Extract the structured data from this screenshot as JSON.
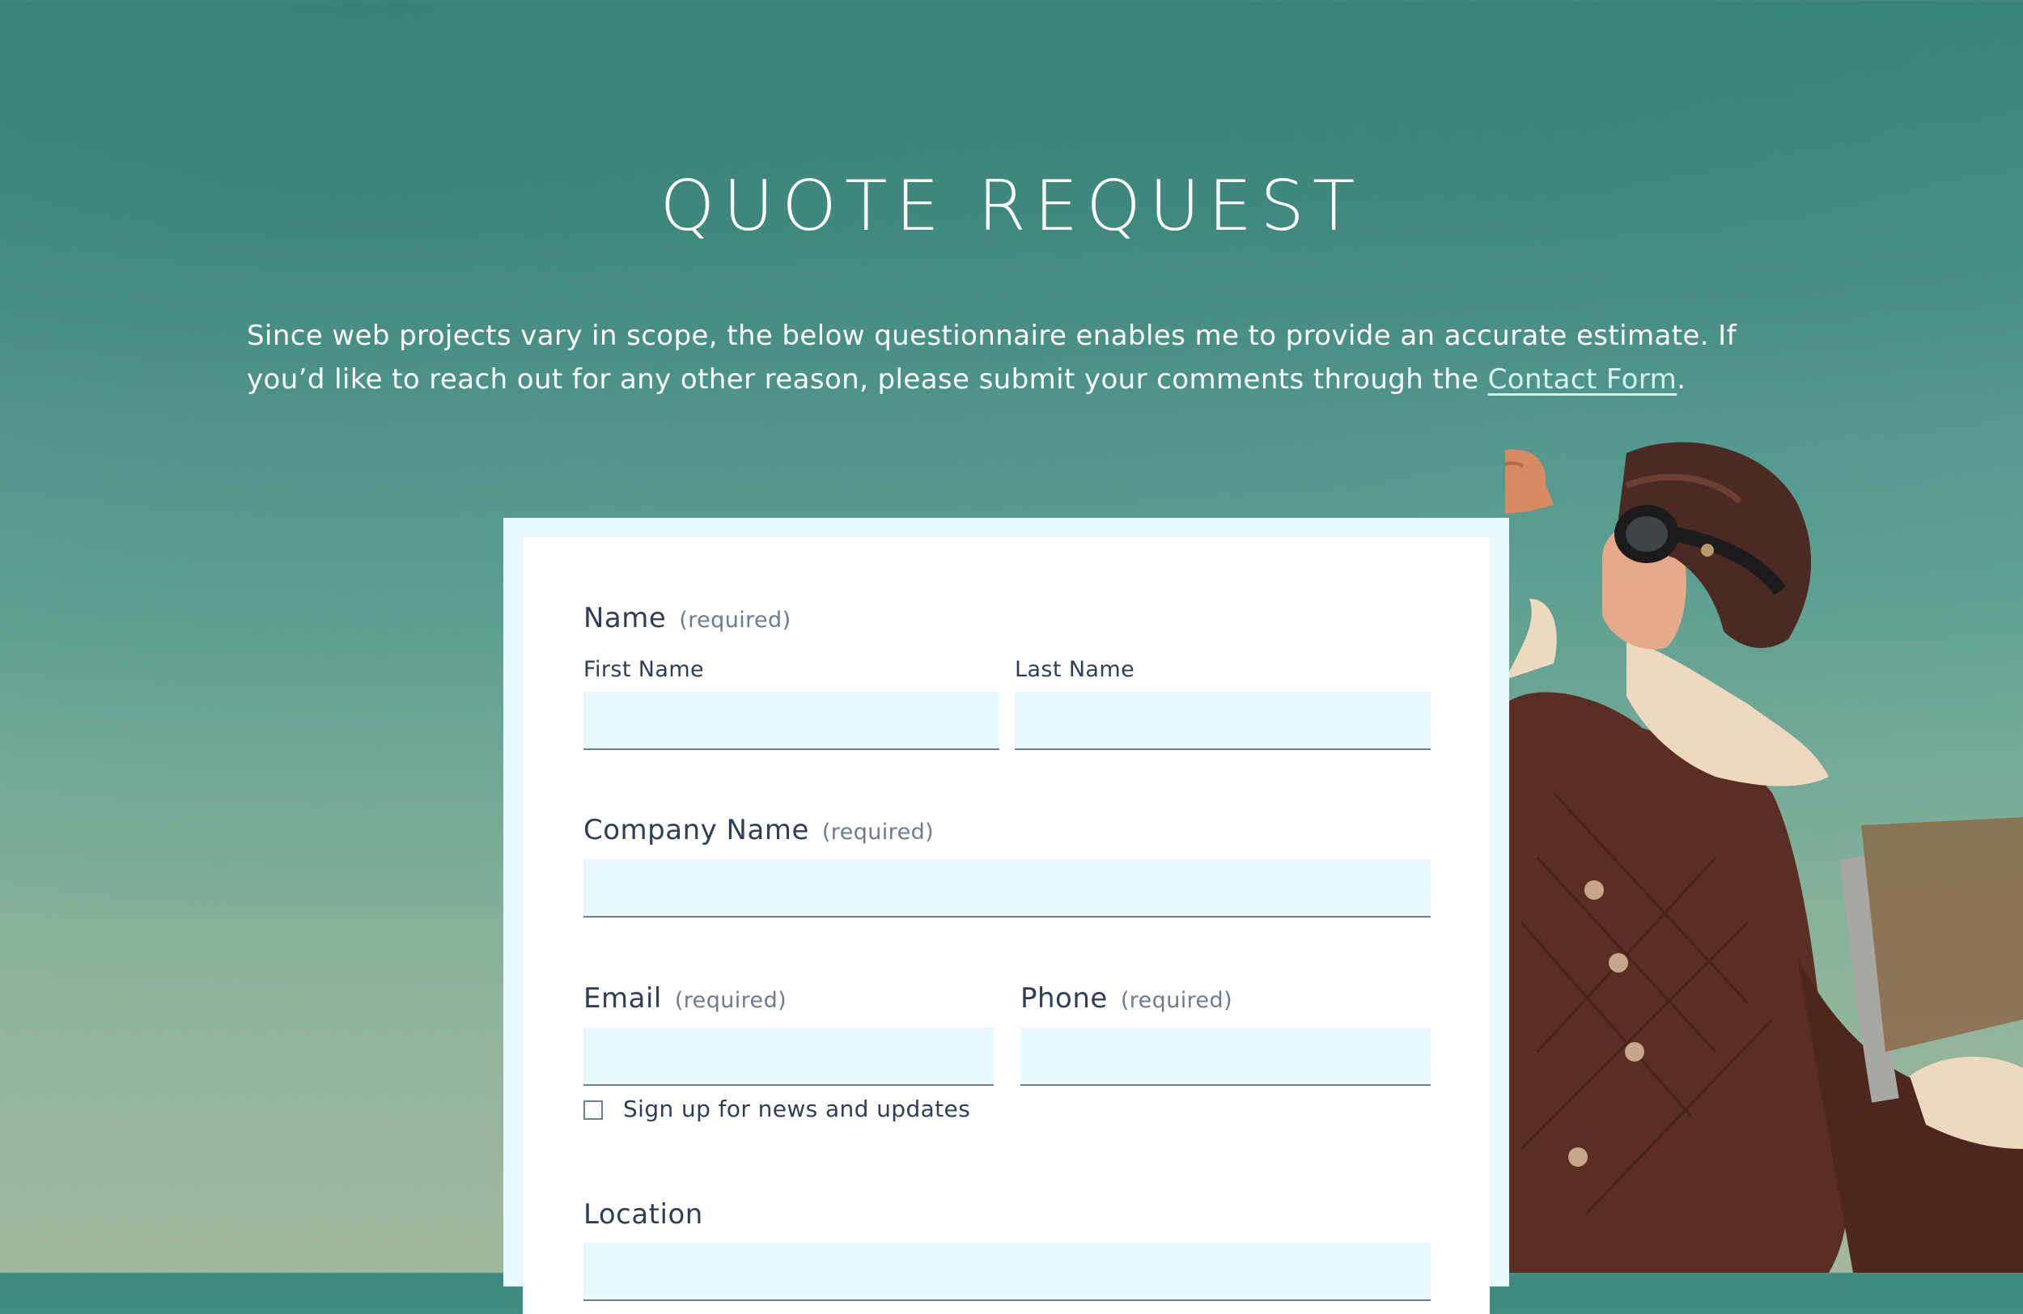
{
  "header": {
    "title": "QUOTE REQUEST",
    "intro_text": "Since web projects vary in scope, the below questionnaire enables me to provide an accurate estimate.  If you’d like to reach out for any other reason, please submit your comments through the ",
    "contact_link": "Contact Form",
    "intro_end": "."
  },
  "form": {
    "name": {
      "label": "Name",
      "required": "(required)",
      "first_label": "First Name",
      "last_label": "Last Name",
      "first_value": "",
      "last_value": ""
    },
    "company": {
      "label": "Company Name",
      "required": "(required)",
      "value": ""
    },
    "email": {
      "label": "Email",
      "required": "(required)",
      "value": ""
    },
    "phone": {
      "label": "Phone",
      "required": "(required)",
      "value": ""
    },
    "newsletter": {
      "label": "Sign up for news and updates",
      "checked": false
    },
    "location": {
      "label": "Location",
      "value": ""
    }
  },
  "colors": {
    "accent_input_bg": "#e7f9fc",
    "text": "#2f3d55",
    "required": "#6e7b8f"
  },
  "icons": {
    "hero_image": "pilot-kid-illustration"
  }
}
